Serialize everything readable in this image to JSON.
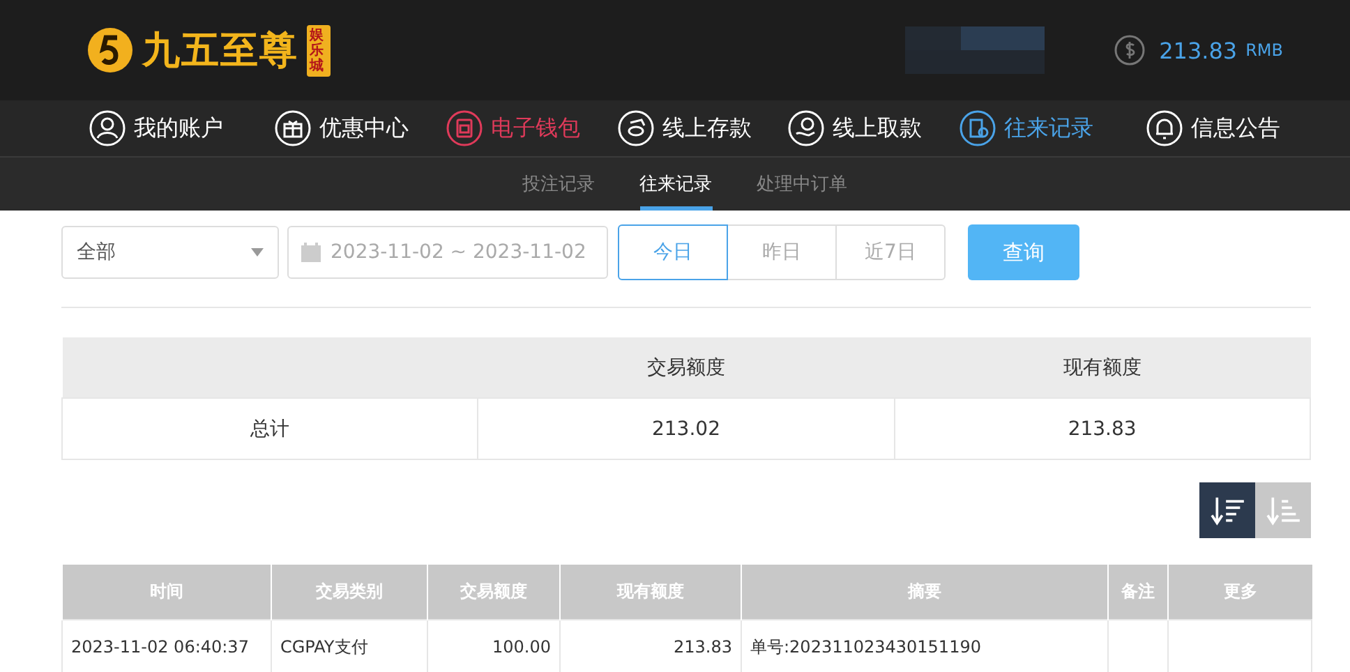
{
  "header": {
    "logo": {
      "name": "九五至尊",
      "badge": "娱乐城"
    },
    "balance": {
      "amount": "213.83",
      "currency": "RMB"
    }
  },
  "nav": [
    {
      "label": "我的账户",
      "kind": "user",
      "hot": false,
      "selected": false
    },
    {
      "label": "优惠中心",
      "kind": "gift",
      "hot": false,
      "selected": false
    },
    {
      "label": "电子钱包",
      "kind": "wallet",
      "hot": true,
      "selected": false
    },
    {
      "label": "线上存款",
      "kind": "deposit",
      "hot": false,
      "selected": false
    },
    {
      "label": "线上取款",
      "kind": "withdraw",
      "hot": false,
      "selected": false
    },
    {
      "label": "往来记录",
      "kind": "records",
      "hot": false,
      "selected": true
    },
    {
      "label": "信息公告",
      "kind": "bell",
      "hot": false,
      "selected": false
    }
  ],
  "subnav": [
    {
      "label": "投注记录",
      "selected": false
    },
    {
      "label": "往来记录",
      "selected": true
    },
    {
      "label": "处理中订单",
      "selected": false
    }
  ],
  "filters": {
    "type_select": "全部",
    "date_range": "2023-11-02 ~ 2023-11-02",
    "quick_ranges": [
      {
        "label": "今日",
        "selected": true
      },
      {
        "label": "昨日",
        "selected": false
      },
      {
        "label": "近7日",
        "selected": false
      }
    ],
    "search_button": "查询"
  },
  "summary": {
    "columns": [
      "",
      "交易额度",
      "现有额度"
    ],
    "rows": [
      [
        "总计",
        "213.02",
        "213.83"
      ]
    ]
  },
  "sort_buttons": [
    {
      "kind": "desc",
      "selected": true
    },
    {
      "kind": "asc",
      "selected": false
    }
  ],
  "table": {
    "columns": [
      "时间",
      "交易类别",
      "交易额度",
      "现有额度",
      "摘要",
      "备注",
      "更多"
    ],
    "rows": [
      [
        "2023-11-02 06:40:37",
        "CGPAY支付",
        "100.00",
        "213.83",
        "单号:202311023430151190",
        "",
        ""
      ]
    ]
  }
}
